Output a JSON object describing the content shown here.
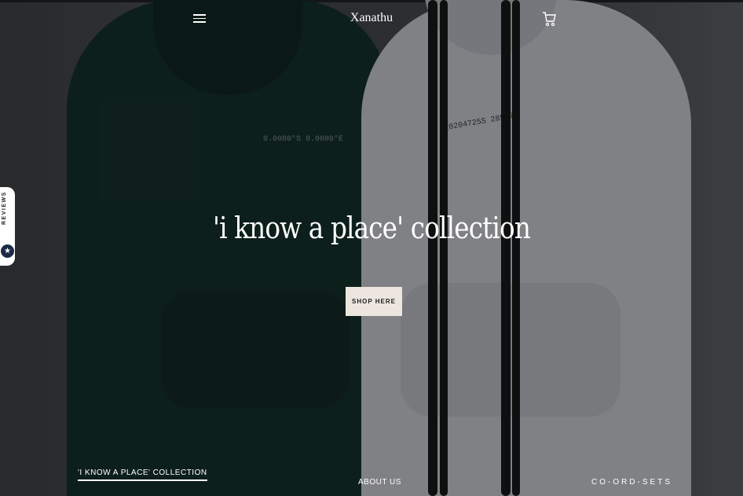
{
  "header": {
    "brand": "Xanathu",
    "menu_icon": "hamburger-menu-icon",
    "cart_icon": "shopping-cart-icon"
  },
  "hero": {
    "headline": "'i know a place' collection",
    "cta_label": "SHOP HERE",
    "cta_bg_color": "#ece6df",
    "dark_print": "0.0000°S 0.0000°E",
    "light_print": "20204725S 28567E"
  },
  "reviews_tab": {
    "label": "REVIEWS",
    "icon": "star-badge-icon"
  },
  "bottom_nav": [
    {
      "label": "'I KNOW A PLACE' COLLECTION",
      "active": true
    },
    {
      "label": "ABOUT US",
      "active": false
    },
    {
      "label": "CO-ORD-SETS",
      "active": false
    }
  ]
}
